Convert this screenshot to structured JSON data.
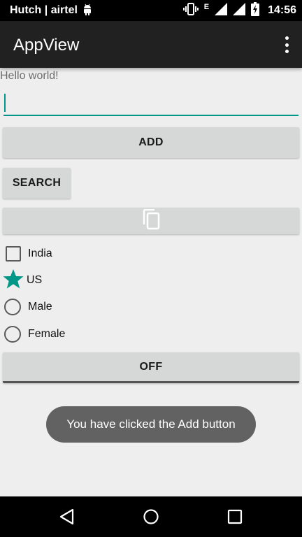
{
  "status_bar": {
    "carrier": "Hutch | airtel",
    "network_type": "E",
    "time": "14:56",
    "icons": [
      "android-icon",
      "vibrate-icon",
      "signal-icon",
      "signal-icon",
      "battery-charging-icon"
    ]
  },
  "app_bar": {
    "title": "AppView",
    "menu_icon": "overflow-menu-icon"
  },
  "content": {
    "hello_text": "Hello world!",
    "text_input": {
      "value": "",
      "placeholder": ""
    },
    "add_button": "ADD",
    "search_button": "SEARCH",
    "copy_button_icon": "copy-icon",
    "checkbox": {
      "label": "India",
      "checked": false
    },
    "star_option": {
      "label": "US",
      "icon": "star-icon"
    },
    "radios": [
      {
        "label": "Male",
        "selected": false
      },
      {
        "label": "Female",
        "selected": false
      }
    ],
    "toggle_button": "OFF"
  },
  "toast": {
    "message": "You have clicked the Add button"
  },
  "nav_bar": {
    "icons": [
      "back-icon",
      "home-icon",
      "recents-icon"
    ]
  },
  "colors": {
    "accent": "#009688",
    "app_bar": "#212121",
    "background": "#eeeeee",
    "button": "#d6d7d7",
    "toast": "#626262"
  }
}
